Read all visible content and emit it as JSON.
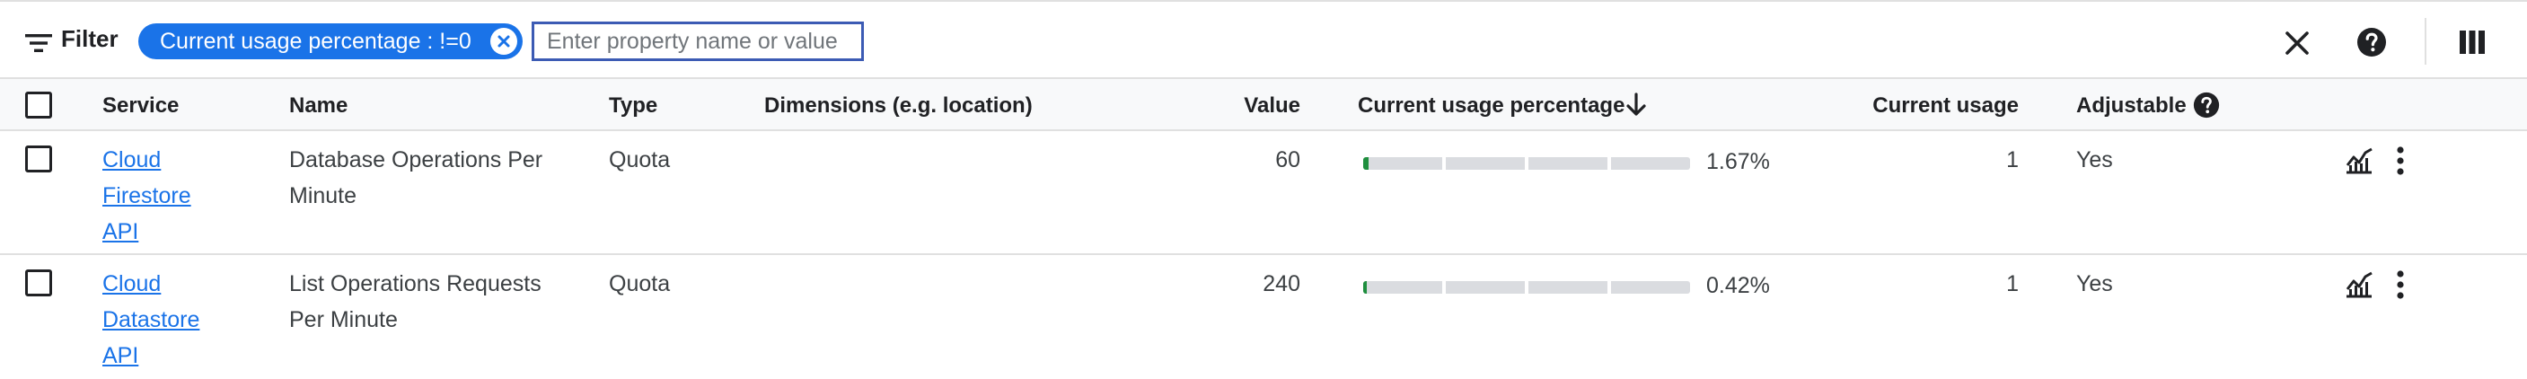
{
  "filter": {
    "label": "Filter",
    "chip_text": "Current usage percentage : !=0",
    "input_placeholder": "Enter property name or value"
  },
  "table": {
    "columns": {
      "service": "Service",
      "name": "Name",
      "type": "Type",
      "dimensions": "Dimensions (e.g. location)",
      "value": "Value",
      "usage_percentage": "Current usage percentage",
      "current_usage": "Current usage",
      "adjustable": "Adjustable"
    },
    "sort": {
      "column": "Current usage percentage",
      "direction": "descending"
    },
    "rows": [
      {
        "service_lines": [
          "Cloud",
          "Firestore",
          "API"
        ],
        "name_lines": [
          "Database Operations Per",
          "Minute"
        ],
        "type": "Quota",
        "dimensions": "",
        "value": "60",
        "usage_fraction": 0.0167,
        "usage_percentage": "1.67%",
        "current_usage": "1",
        "adjustable": "Yes"
      },
      {
        "service_lines": [
          "Cloud",
          "Datastore",
          "API"
        ],
        "name_lines": [
          "List Operations Requests",
          "Per Minute"
        ],
        "type": "Quota",
        "dimensions": "",
        "value": "240",
        "usage_fraction": 0.0042,
        "usage_percentage": "0.42%",
        "current_usage": "1",
        "adjustable": "Yes"
      }
    ]
  },
  "colors": {
    "accent": "#1a73e8",
    "progress_fill": "#1e8e3e",
    "progress_track": "#dadce0",
    "header_bg": "#f8f9fa"
  },
  "icons": {
    "filter": "filter-lines-icon",
    "chip_remove": "close-circle-icon",
    "clear": "close-icon",
    "help": "help-circle-icon",
    "columns": "column-display-icon",
    "sort": "arrow-down-icon",
    "chart": "monitoring-chart-icon",
    "menu": "more-vert-icon"
  }
}
